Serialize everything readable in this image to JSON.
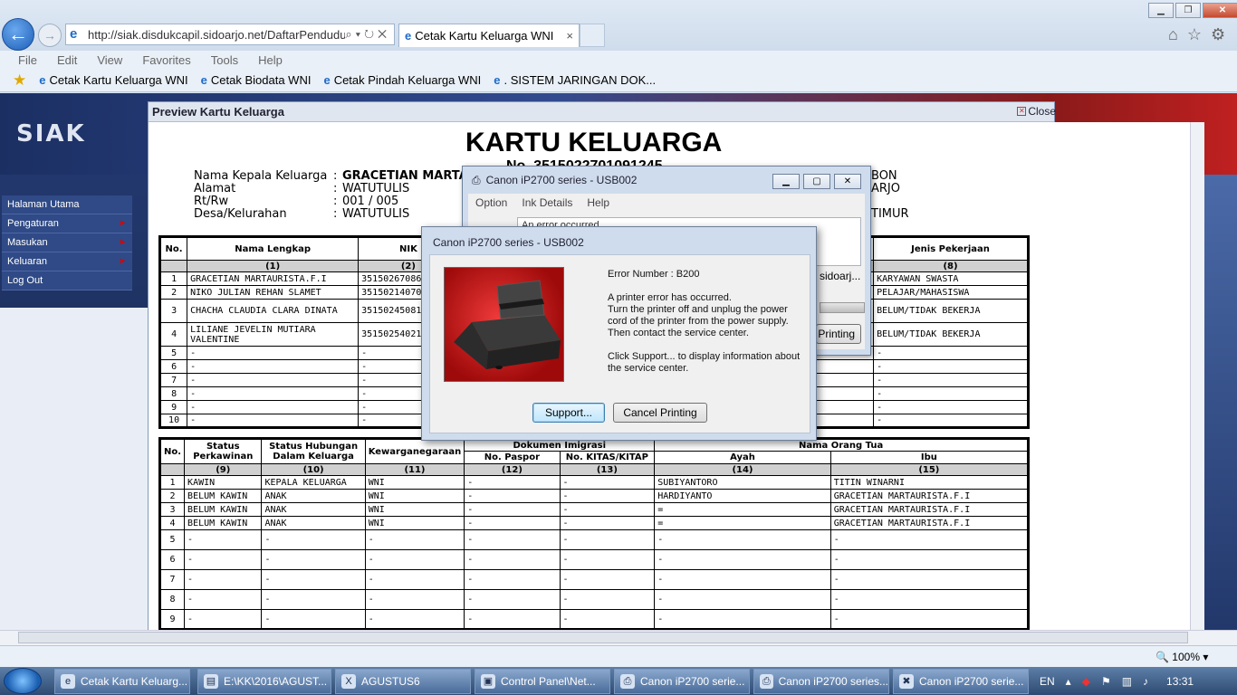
{
  "browser": {
    "address": "http://siak.disdukcapil.sidoarjo.net/DaftarPendudu",
    "tab_title": "Cetak Kartu Keluarga WNI",
    "tab_close": "×",
    "menu": [
      "File",
      "Edit",
      "View",
      "Favorites",
      "Tools",
      "Help"
    ],
    "favorites": [
      "Cetak Kartu Keluarga WNI",
      "Cetak Biodata WNI",
      "Cetak Pindah Keluarga WNI",
      ". SISTEM JARINGAN DOK..."
    ],
    "zoom": "100%"
  },
  "siak": {
    "logo": "SIAK",
    "menu": [
      {
        "label": "Halaman Utama",
        "arrow": ""
      },
      {
        "label": "Pengaturan",
        "arrow": "►"
      },
      {
        "label": "Masukan",
        "arrow": "►"
      },
      {
        "label": "Keluaran",
        "arrow": "►"
      },
      {
        "label": "Log Out",
        "arrow": ""
      }
    ]
  },
  "preview": {
    "header": "Preview Kartu Keluarga",
    "close": "Close",
    "title": "KARTU KELUARGA",
    "number": "No. 3515022701091245",
    "info": [
      {
        "label": "Nama Kepala Keluarga",
        "value": "GRACETIAN MARTAU"
      },
      {
        "label": "Alamat",
        "value": "WATUTULIS"
      },
      {
        "label": "Rt/Rw",
        "value": "001 / 005"
      },
      {
        "label": "Desa/Kelurahan",
        "value": "WATUTULIS"
      }
    ],
    "info_right": [
      "BON",
      "ARJO",
      "",
      "TIMUR"
    ],
    "colon": ":",
    "table1": {
      "headers": [
        "No.",
        "Nama Lengkap",
        "NIK",
        "Jenis Pekerjaan"
      ],
      "numbers": [
        "",
        "(1)",
        "(2)",
        "(8)"
      ],
      "rows": [
        [
          "1",
          "GRACETIAN MARTAURISTA.F.I",
          "351502670868",
          "KARYAWAN SWASTA"
        ],
        [
          "2",
          "NIKO JULIAN REHAN SLAMET",
          "351502140706",
          "PELAJAR/MAHASISWA"
        ],
        [
          "3",
          "CHACHA CLAUDIA CLARA DINATA",
          "351502450812",
          "BELUM/TIDAK BEKERJA"
        ],
        [
          "4",
          "LILIANE JEVELIN MUTIARA VALENTINE",
          "351502540214",
          "BELUM/TIDAK BEKERJA"
        ],
        [
          "5",
          "-",
          "-",
          "-"
        ],
        [
          "6",
          "-",
          "-",
          "-"
        ],
        [
          "7",
          "-",
          "-",
          "-"
        ],
        [
          "8",
          "-",
          "-",
          "-"
        ],
        [
          "9",
          "-",
          "-",
          "-"
        ],
        [
          "10",
          "-",
          "-",
          "-"
        ]
      ]
    },
    "table2": {
      "headers": [
        "No.",
        "Status Perkawinan",
        "Status Hubungan Dalam Keluarga",
        "Kewarganegaraan",
        "Dokumen Imigrasi",
        "Nama Orang Tua"
      ],
      "subheaders": [
        "No. Paspor",
        "No. KITAS/KITAP",
        "Ayah",
        "Ibu"
      ],
      "numbers": [
        "",
        "(9)",
        "(10)",
        "(11)",
        "(12)",
        "(13)",
        "(14)",
        "(15)"
      ],
      "rows": [
        [
          "1",
          "KAWIN",
          "KEPALA KELUARGA",
          "WNI",
          "-",
          "-",
          "SUBIYANTORO",
          "TITIN WINARNI"
        ],
        [
          "2",
          "BELUM KAWIN",
          "ANAK",
          "WNI",
          "-",
          "-",
          "HARDIYANTO",
          "GRACETIAN MARTAURISTA.F.I"
        ],
        [
          "3",
          "BELUM KAWIN",
          "ANAK",
          "WNI",
          "-",
          "-",
          "=",
          "GRACETIAN MARTAURISTA.F.I"
        ],
        [
          "4",
          "BELUM KAWIN",
          "ANAK",
          "WNI",
          "-",
          "-",
          "=",
          "GRACETIAN MARTAURISTA.F.I"
        ],
        [
          "5",
          "-",
          "-",
          "-",
          "-",
          "-",
          "-",
          "-"
        ],
        [
          "6",
          "-",
          "-",
          "-",
          "-",
          "-",
          "-",
          "-"
        ],
        [
          "7",
          "-",
          "-",
          "-",
          "-",
          "-",
          "-",
          "-"
        ],
        [
          "8",
          "-",
          "-",
          "-",
          "-",
          "-",
          "-",
          "-"
        ],
        [
          "9",
          "-",
          "-",
          "-",
          "-",
          "-",
          "-",
          "-"
        ]
      ]
    }
  },
  "status_dialog": {
    "title": "Canon iP2700 series - USB002",
    "menu": [
      "Option",
      "Ink Details",
      "Help"
    ],
    "text": "An error occurred",
    "port_text": "sidoarj...",
    "button_partial": "Printing"
  },
  "error_dialog": {
    "title": "Canon iP2700 series - USB002",
    "error_number": "Error Number : B200",
    "lines": [
      "A printer error has occurred.",
      "Turn the printer off and unplug the power cord of the printer from the power supply.",
      "Then contact the service center."
    ],
    "support_text": "Click Support... to display information about the service center.",
    "support_button": "Support...",
    "cancel_button": "Cancel Printing"
  },
  "taskbar": {
    "items": [
      {
        "label": "Cetak Kartu Keluarg...",
        "icon": "e"
      },
      {
        "label": "E:\\KK\\2016\\AGUST...",
        "icon": "▤"
      },
      {
        "label": "AGUSTUS6",
        "icon": "X"
      },
      {
        "label": "Control Panel\\Net...",
        "icon": "▣"
      },
      {
        "label": "Canon iP2700 serie...",
        "icon": "⎙"
      },
      {
        "label": "Canon iP2700 series...",
        "icon": "⎙"
      },
      {
        "label": "Canon iP2700 serie...",
        "icon": "✖"
      }
    ],
    "lang": "EN",
    "time": "13:31"
  }
}
